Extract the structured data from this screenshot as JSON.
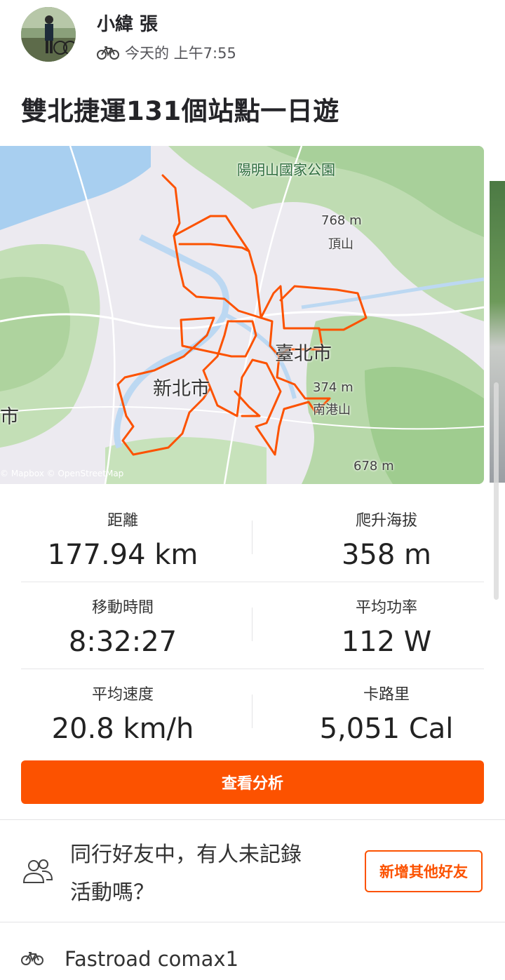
{
  "header": {
    "user_name": "小緯 張",
    "activity_type_icon": "bike-icon",
    "timestamp": "今天的 上午7:55"
  },
  "activity": {
    "title": "雙北捷運131個站點一日遊"
  },
  "map": {
    "labels": {
      "park": "陽明山國家公園",
      "peak1_height": "768 m",
      "peak1_name": "頂山",
      "city_taipei": "臺北市",
      "city_newtaipei": "新北市",
      "peak2_height": "374 m",
      "peak2_name": "南港山",
      "peak3_height": "678 m",
      "edge_city": "市"
    },
    "attribution": "© Mapbox © OpenStreetMap",
    "route_color": "#fc5200"
  },
  "stats": [
    {
      "label": "距離",
      "value": "177.94 km"
    },
    {
      "label": "爬升海拔",
      "value": "358 m"
    },
    {
      "label": "移動時間",
      "value": "8:32:27"
    },
    {
      "label": "平均功率",
      "value": "112 W"
    },
    {
      "label": "平均速度",
      "value": "20.8 km/h"
    },
    {
      "label": "卡路里",
      "value": "5,051 Cal"
    }
  ],
  "actions": {
    "view_analysis": "查看分析"
  },
  "friends": {
    "icon": "people-icon",
    "prompt_line1": "同行好友中，有人未記錄",
    "prompt_line2": "活動嗎？",
    "add_button": "新增其他好友"
  },
  "gear": {
    "icon": "bike-icon",
    "name": "Fastroad comax1"
  },
  "colors": {
    "accent": "#fc5200",
    "text": "#242428",
    "muted": "#55555a"
  }
}
